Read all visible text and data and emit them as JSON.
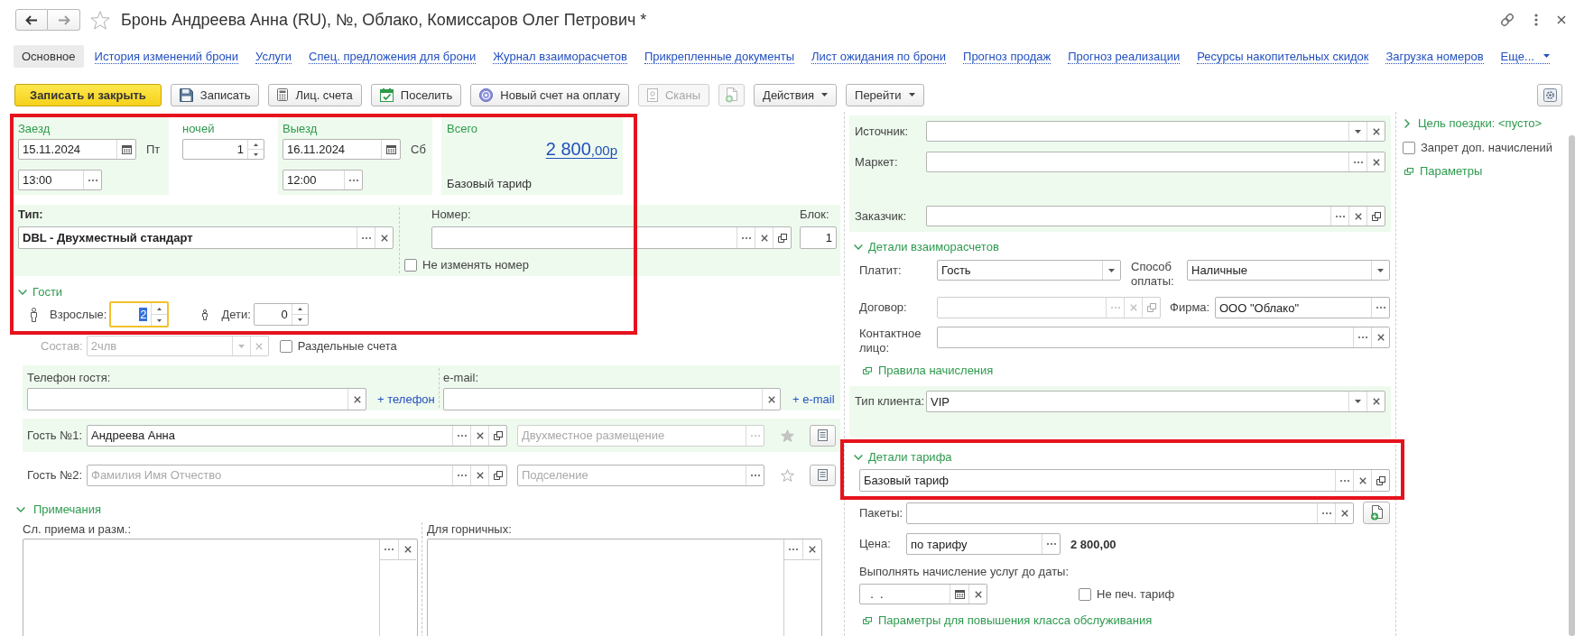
{
  "window": {
    "title": "Бронь Андреева Анна (RU), №, Облако, Комиссаров Олег Петрович *"
  },
  "tabs": [
    {
      "label": "Основное",
      "selected": true
    },
    {
      "label": "История изменений брони",
      "selected": false
    },
    {
      "label": "Услуги",
      "selected": false
    },
    {
      "label": "Спец. предложения для брони",
      "selected": false
    },
    {
      "label": "Журнал взаиморасчетов",
      "selected": false
    },
    {
      "label": "Прикрепленные документы",
      "selected": false
    },
    {
      "label": "Лист ожидания по брони",
      "selected": false
    },
    {
      "label": "Прогноз продаж",
      "selected": false
    },
    {
      "label": "Прогноз реализации",
      "selected": false
    },
    {
      "label": "Ресурсы накопительных скидок",
      "selected": false
    },
    {
      "label": "Загрузка номеров",
      "selected": false
    }
  ],
  "more_tabs": "Еще...",
  "toolbar": [
    {
      "kind": "primary",
      "label": "Записать и закрыть",
      "disabled": false
    },
    {
      "kind": "save",
      "label": "Записать",
      "disabled": false
    },
    {
      "kind": "ledger",
      "label": "Лиц. счета",
      "disabled": false
    },
    {
      "kind": "checkin",
      "label": "Поселить",
      "disabled": false
    },
    {
      "kind": "invoice",
      "label": "Новый счет на оплату",
      "disabled": false
    },
    {
      "kind": "scans",
      "label": "Сканы",
      "disabled": true
    },
    {
      "kind": "attach",
      "disabled": true
    },
    {
      "kind": "menu",
      "label": "Действия",
      "disabled": false
    },
    {
      "kind": "menu",
      "label": "Перейти",
      "disabled": false
    }
  ],
  "stay": {
    "highlighted": true,
    "arrival": {
      "label": "Заезд",
      "date": "15.11.2024",
      "weekday": "Пт",
      "time": "13:00"
    },
    "nights": {
      "label": "ночей",
      "value": "1"
    },
    "departure": {
      "label": "Выезд",
      "date": "16.11.2024",
      "weekday": "Сб",
      "time": "12:00"
    },
    "total": {
      "label": "Всего",
      "amount": "2 800",
      "fraction": ",00р",
      "tariff": "Базовый тариф"
    }
  },
  "room": {
    "type": {
      "label": "Тип:",
      "value": "DBL - Двухместный стандарт"
    },
    "number": {
      "label": "Номер:"
    },
    "block": {
      "label": "Блок:",
      "value": "1"
    },
    "keep_number": {
      "label": "Не изменять номер",
      "checked": false
    }
  },
  "guests": {
    "title": "Гости",
    "expanded": true,
    "adults": {
      "label": "Взрослые:",
      "value": "2",
      "focused": true
    },
    "children": {
      "label": "Дети:",
      "value": "0",
      "focused": false
    },
    "composition": {
      "label": "Состав:",
      "value": "2члв",
      "disabled": true
    },
    "separate_accounts": {
      "label": "Раздельные счета",
      "checked": false
    }
  },
  "contacts": {
    "phone": {
      "label": "Телефон гостя:",
      "add_link": "+ телефон"
    },
    "email": {
      "label": "e-mail:",
      "add_link": "+ e-mail"
    }
  },
  "guest_rows": [
    {
      "label": "Гость №1:",
      "value": "Андреева Анна",
      "placement": {
        "value": "Двухместное размещение",
        "disabled": true
      },
      "selected": true,
      "starred": true
    },
    {
      "label": "Гость №2:",
      "placeholder": "Фамилия Имя Отчество",
      "placement": {
        "placeholder": "Подселение",
        "disabled": false
      },
      "selected": false,
      "starred": false
    }
  ],
  "notes": {
    "title": "Примечания",
    "expanded": true,
    "fields": [
      {
        "label": "Сл. приема и разм.:"
      },
      {
        "label": "Для горничных:"
      }
    ]
  },
  "booking_source": {
    "fields": [
      {
        "label": "Источник:",
        "kind": "select"
      },
      {
        "label": "Маркет:",
        "kind": "choice"
      },
      {
        "label": "Заказчик:",
        "kind": "ref"
      }
    ]
  },
  "settlement": {
    "title": "Детали взаиморасчетов",
    "expanded": true,
    "payer": {
      "label": "Платит:",
      "value": "Гость"
    },
    "payment_method": {
      "label": "Способ оплаты:",
      "value": "Наличные"
    },
    "contract": {
      "label": "Договор:",
      "disabled": true
    },
    "firm": {
      "label": "Фирма:",
      "value": "ООО \"Облако\""
    },
    "contact": {
      "label": "Контактное лицо:"
    },
    "rules_link": "Правила начисления"
  },
  "client_type": {
    "label": "Тип клиента:",
    "value": "VIP"
  },
  "tariff": {
    "title": "Детали тарифа",
    "expanded": true,
    "highlighted": true,
    "value": "Базовый тариф",
    "packages": {
      "label": "Пакеты:"
    },
    "price": {
      "label": "Цена:",
      "mode": "по тарифу",
      "amount": "2 800,00"
    },
    "charge_until": {
      "label": "Выполнять начисление услуг до даты:",
      "value": "  .  ."
    },
    "no_print": {
      "label": "Не печ. тариф",
      "checked": false
    },
    "upgrade_link": "Параметры для повышения класса обслуживания"
  },
  "side": {
    "trip_purpose": {
      "label": "Цель поездки: <пусто>",
      "expanded": false
    },
    "no_extra_charges": {
      "label": "Запрет доп. начислений",
      "checked": false
    },
    "params_link": "Параметры"
  }
}
